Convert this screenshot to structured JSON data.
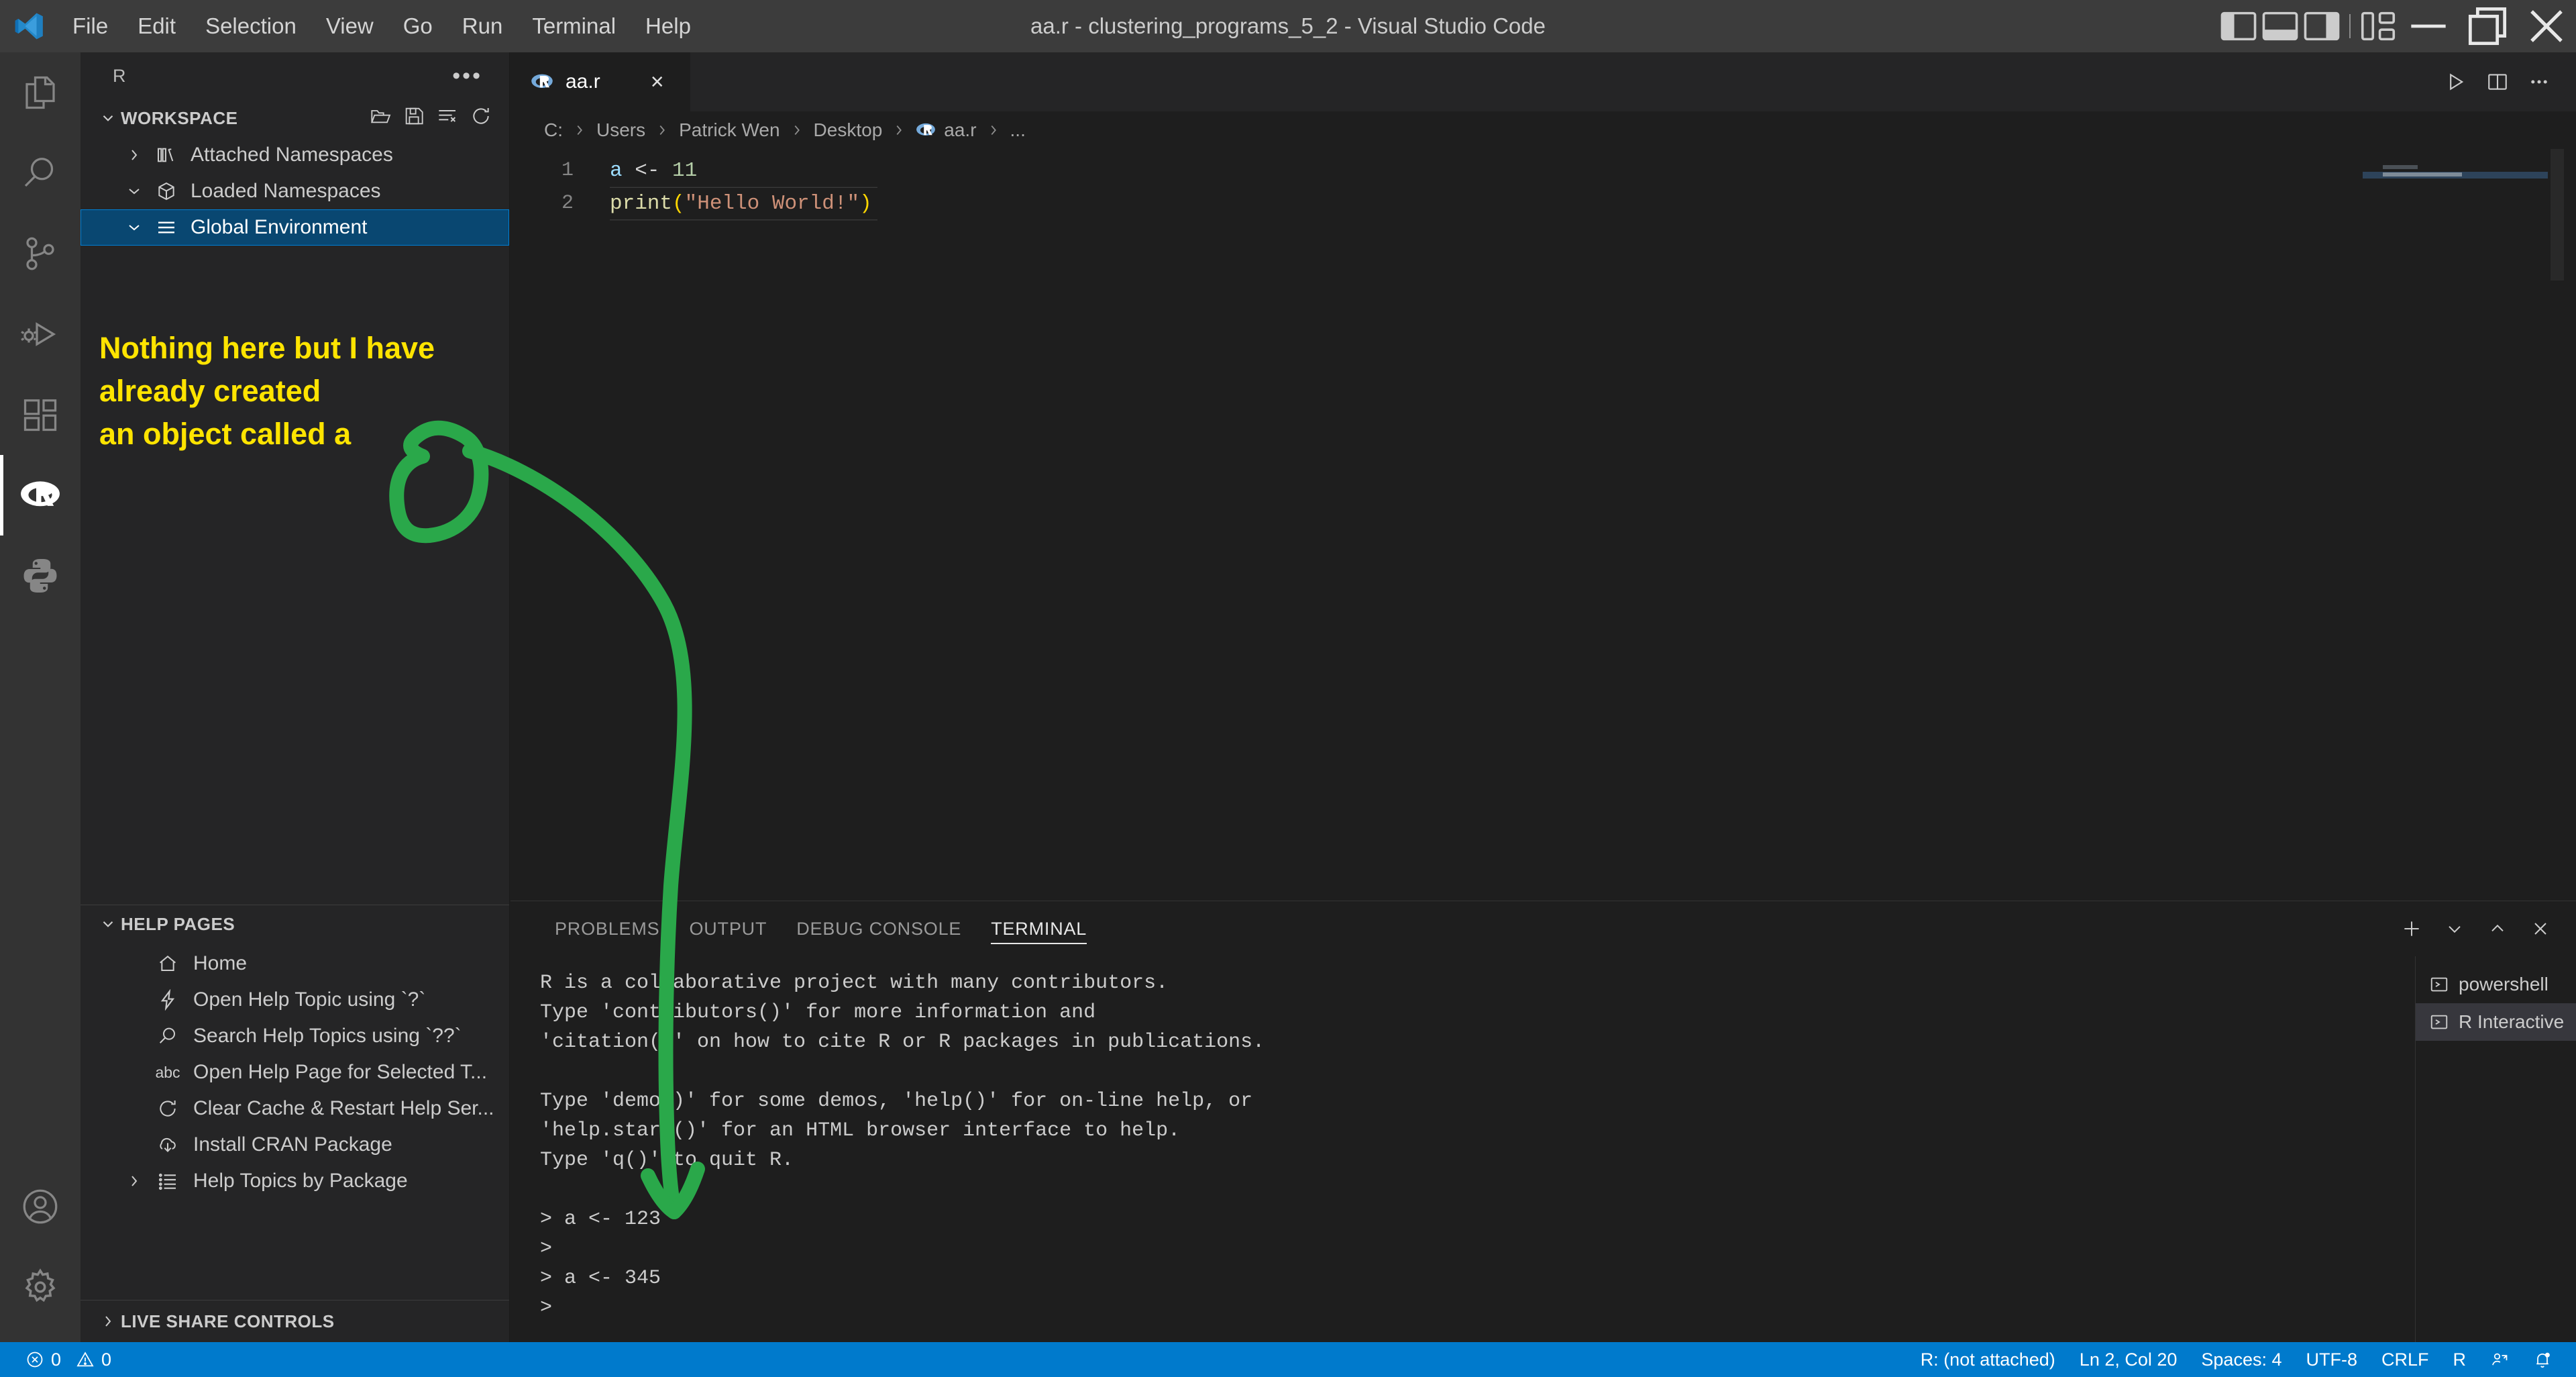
{
  "window": {
    "title": "aa.r - clustering_programs_5_2 - Visual Studio Code",
    "menu": [
      "File",
      "Edit",
      "Selection",
      "View",
      "Go",
      "Run",
      "Terminal",
      "Help"
    ],
    "controls": {
      "toggle_primary_sidebar": "toggle-primary-sidebar",
      "toggle_panel": "toggle-panel",
      "toggle_secondary_sidebar": "toggle-secondary-sidebar",
      "customize_layout": "customize-layout",
      "minimize": "minimize",
      "restore": "restore",
      "close": "close"
    }
  },
  "activity_bar": {
    "items": [
      {
        "name": "explorer",
        "icon": "files-icon",
        "active": false
      },
      {
        "name": "search",
        "icon": "search-icon",
        "active": false
      },
      {
        "name": "source-control",
        "icon": "source-control-icon",
        "active": false
      },
      {
        "name": "run-and-debug",
        "icon": "debug-icon",
        "active": false
      },
      {
        "name": "extensions",
        "icon": "extensions-icon",
        "active": false
      },
      {
        "name": "r-workspace",
        "icon": "r-logo-icon",
        "active": true
      },
      {
        "name": "python",
        "icon": "python-icon",
        "active": false
      }
    ],
    "bottom_items": [
      {
        "name": "accounts",
        "icon": "account-icon"
      },
      {
        "name": "manage",
        "icon": "gear-icon"
      }
    ]
  },
  "sidebar": {
    "title": "R",
    "more_actions": "•••",
    "workspace": {
      "header": "WORKSPACE",
      "expanded": true,
      "actions": [
        "load-workspace-icon",
        "save-workspace-icon",
        "clear-workspace-icon",
        "refresh-icon"
      ],
      "items": [
        {
          "label": "Attached Namespaces",
          "icon": "library-icon",
          "expanded": false,
          "selected": false
        },
        {
          "label": "Loaded Namespaces",
          "icon": "package-icon",
          "expanded": true,
          "selected": false
        },
        {
          "label": "Global Environment",
          "icon": "list-icon",
          "expanded": true,
          "selected": true
        }
      ]
    },
    "help_pages": {
      "header": "HELP PAGES",
      "expanded": true,
      "items": [
        {
          "label": "Home",
          "icon": "home-icon",
          "twisty": false
        },
        {
          "label": "Open Help Topic using `?`",
          "icon": "zap-icon",
          "twisty": false
        },
        {
          "label": "Search Help Topics using `??`",
          "icon": "search-icon",
          "twisty": false
        },
        {
          "label": "Open Help Page for Selected T...",
          "icon": "abc-icon",
          "twisty": false
        },
        {
          "label": "Clear Cache & Restart Help Ser...",
          "icon": "refresh-icon",
          "twisty": false
        },
        {
          "label": "Install CRAN Package",
          "icon": "cloud-download-icon",
          "twisty": false
        },
        {
          "label": "Help Topics by Package",
          "icon": "list-tree-icon",
          "twisty": true
        }
      ]
    },
    "live_share": {
      "header": "LIVE SHARE CONTROLS",
      "expanded": false
    }
  },
  "annotation": {
    "lines": [
      "Nothing here but I have",
      "already created",
      "an object called a"
    ],
    "text_color": "#ffe400",
    "arrow_color": "#2aa84a"
  },
  "editor": {
    "tabs": [
      {
        "label": "aa.r",
        "icon": "r-file-icon",
        "active": true,
        "close": "×"
      }
    ],
    "tab_actions": [
      "run-icon",
      "split-editor-icon",
      "more-actions-icon"
    ],
    "breadcrumb": [
      {
        "label": "C:",
        "icon": null
      },
      {
        "label": "Users",
        "icon": null
      },
      {
        "label": "Patrick Wen",
        "icon": null
      },
      {
        "label": "Desktop",
        "icon": null
      },
      {
        "label": "aa.r",
        "icon": "r-file-icon"
      },
      {
        "label": "...",
        "icon": null
      }
    ],
    "code": [
      {
        "number": "1",
        "current": false,
        "tokens": [
          {
            "text": "a",
            "type": "var"
          },
          {
            "text": " ",
            "type": "op"
          },
          {
            "text": "<-",
            "type": "op"
          },
          {
            "text": " ",
            "type": "op"
          },
          {
            "text": "11",
            "type": "num"
          }
        ]
      },
      {
        "number": "2",
        "current": true,
        "tokens": [
          {
            "text": "print",
            "type": "fn"
          },
          {
            "text": "(",
            "type": "paren"
          },
          {
            "text": "\"Hello World!\"",
            "type": "str"
          },
          {
            "text": ")",
            "type": "paren"
          }
        ]
      }
    ]
  },
  "panel": {
    "tabs": [
      {
        "label": "PROBLEMS",
        "active": false
      },
      {
        "label": "OUTPUT",
        "active": false
      },
      {
        "label": "DEBUG CONSOLE",
        "active": false
      },
      {
        "label": "TERMINAL",
        "active": true
      }
    ],
    "actions": [
      "new-terminal-icon",
      "chevron-down-icon",
      "chevron-up-icon",
      "close-icon"
    ],
    "terminal_output": "R is a collaborative project with many contributors.\nType 'contributors()' for more information and\n'citation()' on how to cite R or R packages in publications.\n\nType 'demo()' for some demos, 'help()' for on-line help, or\n'help.start()' for an HTML browser interface to help.\nType 'q()' to quit R.\n\n> a <- 123\n>\n> a <- 345\n>",
    "instances": [
      {
        "label": "powershell",
        "icon": "terminal-icon",
        "active": false
      },
      {
        "label": "R Interactive",
        "icon": "terminal-icon",
        "active": true
      }
    ]
  },
  "status_bar": {
    "left": [
      {
        "name": "errors-warnings",
        "icon": "error-icon",
        "label": "0",
        "icon2": "warning-icon",
        "label2": "0"
      }
    ],
    "right": [
      {
        "name": "r-status",
        "label": "R: (not attached)"
      },
      {
        "name": "cursor-position",
        "label": "Ln 2, Col 20"
      },
      {
        "name": "indentation",
        "label": "Spaces: 4"
      },
      {
        "name": "encoding",
        "label": "UTF-8"
      },
      {
        "name": "eol",
        "label": "CRLF"
      },
      {
        "name": "language-mode",
        "label": "R"
      },
      {
        "name": "live-share",
        "icon": "live-share-icon",
        "label": ""
      },
      {
        "name": "notifications",
        "icon": "bell-icon",
        "label": ""
      }
    ]
  },
  "colors": {
    "titlebar": "#3c3c3c",
    "activitybar": "#333333",
    "sidebar": "#252526",
    "editor": "#1e1e1e",
    "statusbar": "#007acc",
    "selection": "#094771",
    "selection_border": "#007fd4"
  }
}
